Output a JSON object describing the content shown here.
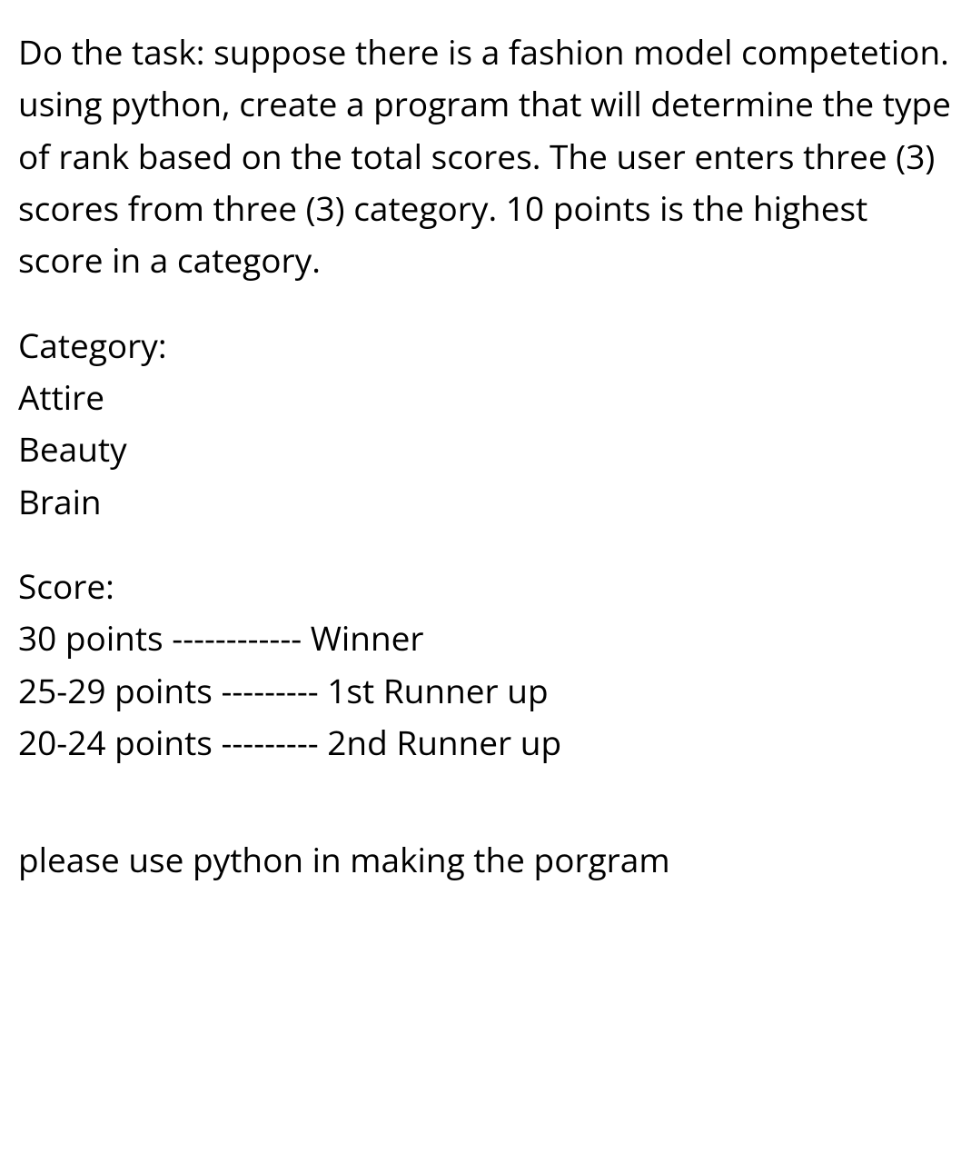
{
  "task": {
    "description": "Do the task: suppose there is a fashion model competetion. using python, create a program that will determine the type of rank based on the total scores. The user enters three (3) scores from three (3) category. 10 points is the highest score in a category."
  },
  "category": {
    "header": "Category:",
    "items": [
      "Attire",
      "Beauty",
      "Brain"
    ]
  },
  "score": {
    "header": "Score:",
    "lines": [
      "30 points ------------ Winner",
      "25-29 points --------- 1st Runner up",
      "20-24 points --------- 2nd Runner up"
    ]
  },
  "footer": {
    "note": "please use python in making the porgram"
  }
}
